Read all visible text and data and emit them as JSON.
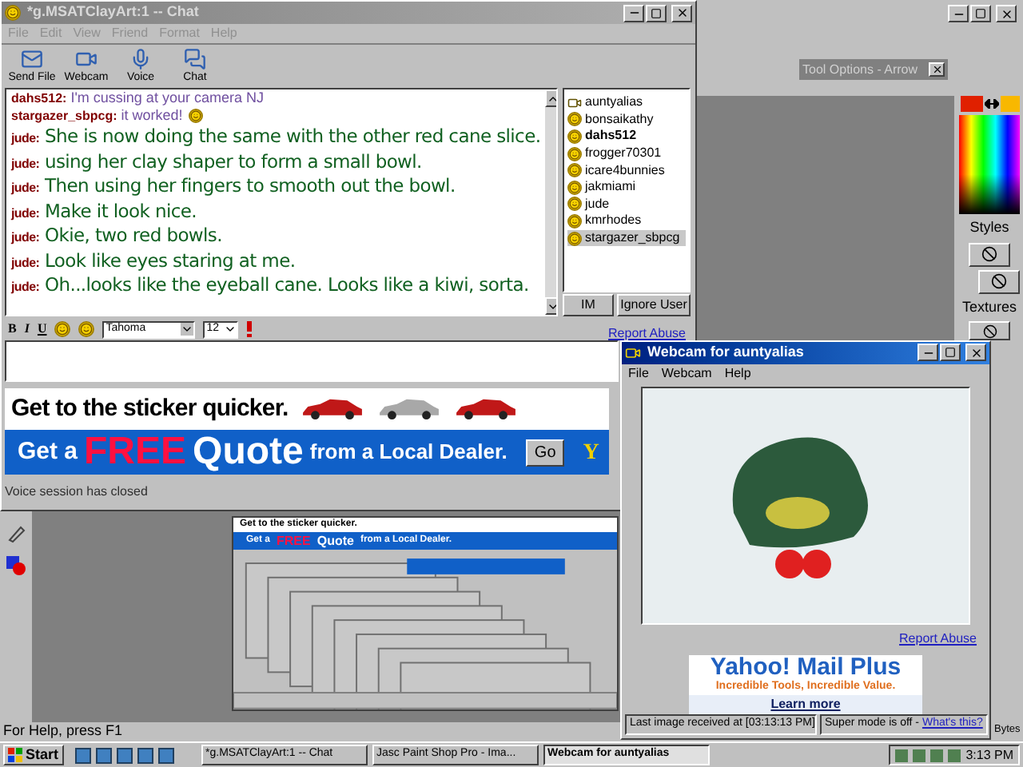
{
  "psp": {
    "tool_options_title": "Tool Options - Arrow",
    "styles_label": "Styles",
    "textures_label": "Textures",
    "status": "For Help, press F1",
    "status_right": "Bytes"
  },
  "chat_window": {
    "title": "*g.MSATClayArt:1 -- Chat",
    "menu": [
      "File",
      "Edit",
      "View",
      "Friend",
      "Format",
      "Help"
    ],
    "toolbar": [
      {
        "label": "Send File",
        "kind": "file"
      },
      {
        "label": "Webcam",
        "kind": "webcam"
      },
      {
        "label": "Voice",
        "kind": "voice"
      },
      {
        "label": "Chat",
        "kind": "chat"
      }
    ],
    "messages": [
      {
        "user": "dahs512:",
        "text": "I'm cussing at your camera NJ",
        "kind": "system",
        "smiley": false
      },
      {
        "user": "stargazer_sbpcg:",
        "text": "it worked!",
        "kind": "system",
        "smiley": true
      },
      {
        "user": "jude:",
        "text": "She is now doing the same with the other red cane slice.",
        "kind": "chat",
        "smiley": false
      },
      {
        "user": "jude:",
        "text": "using her clay shaper to form a small bowl.",
        "kind": "chat",
        "smiley": false
      },
      {
        "user": "jude:",
        "text": "Then using her fingers to smooth out the bowl.",
        "kind": "chat",
        "smiley": false
      },
      {
        "user": "jude:",
        "text": "Make it look nice.",
        "kind": "chat",
        "smiley": false
      },
      {
        "user": "jude:",
        "text": "Okie, two red bowls.",
        "kind": "chat",
        "smiley": false
      },
      {
        "user": "jude:",
        "text": "Look like eyes staring at me.",
        "kind": "chat",
        "smiley": false
      },
      {
        "user": "jude:",
        "text": "Oh...looks like the eyeball cane. Looks like a kiwi, sorta.",
        "kind": "chat",
        "smiley": false
      }
    ],
    "users": [
      {
        "name": "auntyalias",
        "kind": "webcam",
        "bold": false,
        "selected": false
      },
      {
        "name": "bonsaikathy",
        "kind": "smiley",
        "bold": false,
        "selected": false
      },
      {
        "name": "dahs512",
        "kind": "smiley",
        "bold": true,
        "selected": false
      },
      {
        "name": "frogger70301",
        "kind": "smiley",
        "bold": false,
        "selected": false
      },
      {
        "name": "icare4bunnies",
        "kind": "smiley",
        "bold": false,
        "selected": false
      },
      {
        "name": "jakmiami",
        "kind": "smiley",
        "bold": false,
        "selected": false
      },
      {
        "name": "jude",
        "kind": "smiley",
        "bold": false,
        "selected": false
      },
      {
        "name": "kmrhodes",
        "kind": "smiley",
        "bold": false,
        "selected": false
      },
      {
        "name": "stargazer_sbpcg",
        "kind": "smiley",
        "bold": false,
        "selected": true
      }
    ],
    "user_buttons": [
      "IM",
      "Ignore User"
    ],
    "format_bar": {
      "bold": "B",
      "italic": "I",
      "underline": "U",
      "font": "Tahoma",
      "size": "12"
    },
    "report_link": "Report Abuse",
    "ad": {
      "headline": "Get to the sticker quicker.",
      "get_a": "Get a",
      "free": "FREE",
      "quote": "Quote",
      "rest": "from a Local Dealer.",
      "go": "Go",
      "logo": "Y"
    },
    "status": "Voice session has closed"
  },
  "nested_capture": {
    "headline": "Get to the sticker quicker.",
    "get_a": "Get a",
    "free": "FREE",
    "quote": "Quote",
    "rest": "from a Local Dealer."
  },
  "webcam_window": {
    "title": "Webcam for auntyalias",
    "menu": [
      "File",
      "Webcam",
      "Help"
    ],
    "report_link": "Report Abuse",
    "ad": {
      "title": "Yahoo! Mail Plus",
      "tagline": "Incredible Tools, Incredible Value.",
      "link": "Learn more"
    },
    "status": "Last image received at [03:13:13 PM]",
    "super_mode": "Super mode is off -",
    "whats_this": "What's this?"
  },
  "taskbar": {
    "start": "Start",
    "tasks": [
      {
        "label": "*g.MSATClayArt:1 -- Chat",
        "selected": false
      },
      {
        "label": "Jasc Paint Shop Pro - Ima...",
        "selected": false
      },
      {
        "label": "Webcam for auntyalias",
        "selected": true
      }
    ],
    "clock": "3:13 PM"
  }
}
